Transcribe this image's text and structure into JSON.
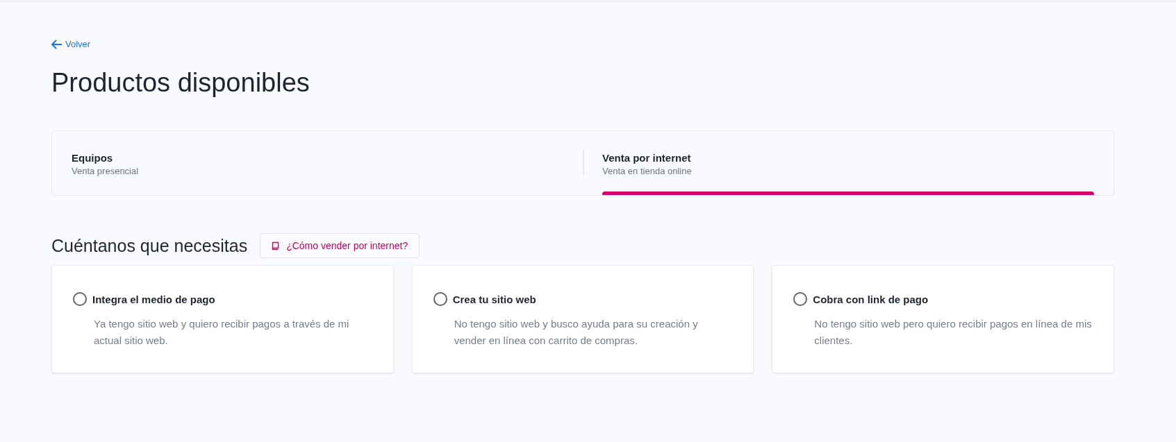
{
  "back_link": {
    "label": "Volver"
  },
  "title": "Productos disponibles",
  "tabs": [
    {
      "label": "Equipos",
      "sublabel": "Venta presencial",
      "selected": false
    },
    {
      "label": "Venta por internet",
      "sublabel": "Venta en tienda online",
      "selected": true
    }
  ],
  "section": {
    "heading": "Cuéntanos que necesitas",
    "help_button": "¿Cómo vender por internet?"
  },
  "options": [
    {
      "title": "Integra el medio de pago",
      "description": "Ya tengo sitio web y quiero recibir pagos a través de mi actual sitio web.",
      "selected": false
    },
    {
      "title": "Crea tu sitio web",
      "description": "No tengo sitio web y busco ayuda para su creación y vender en línea con carrito de compras.",
      "selected": false
    },
    {
      "title": "Cobra con link de pago",
      "description": "No tengo sitio web pero quiero recibir pagos en línea de mis clientes.",
      "selected": false
    }
  ]
}
